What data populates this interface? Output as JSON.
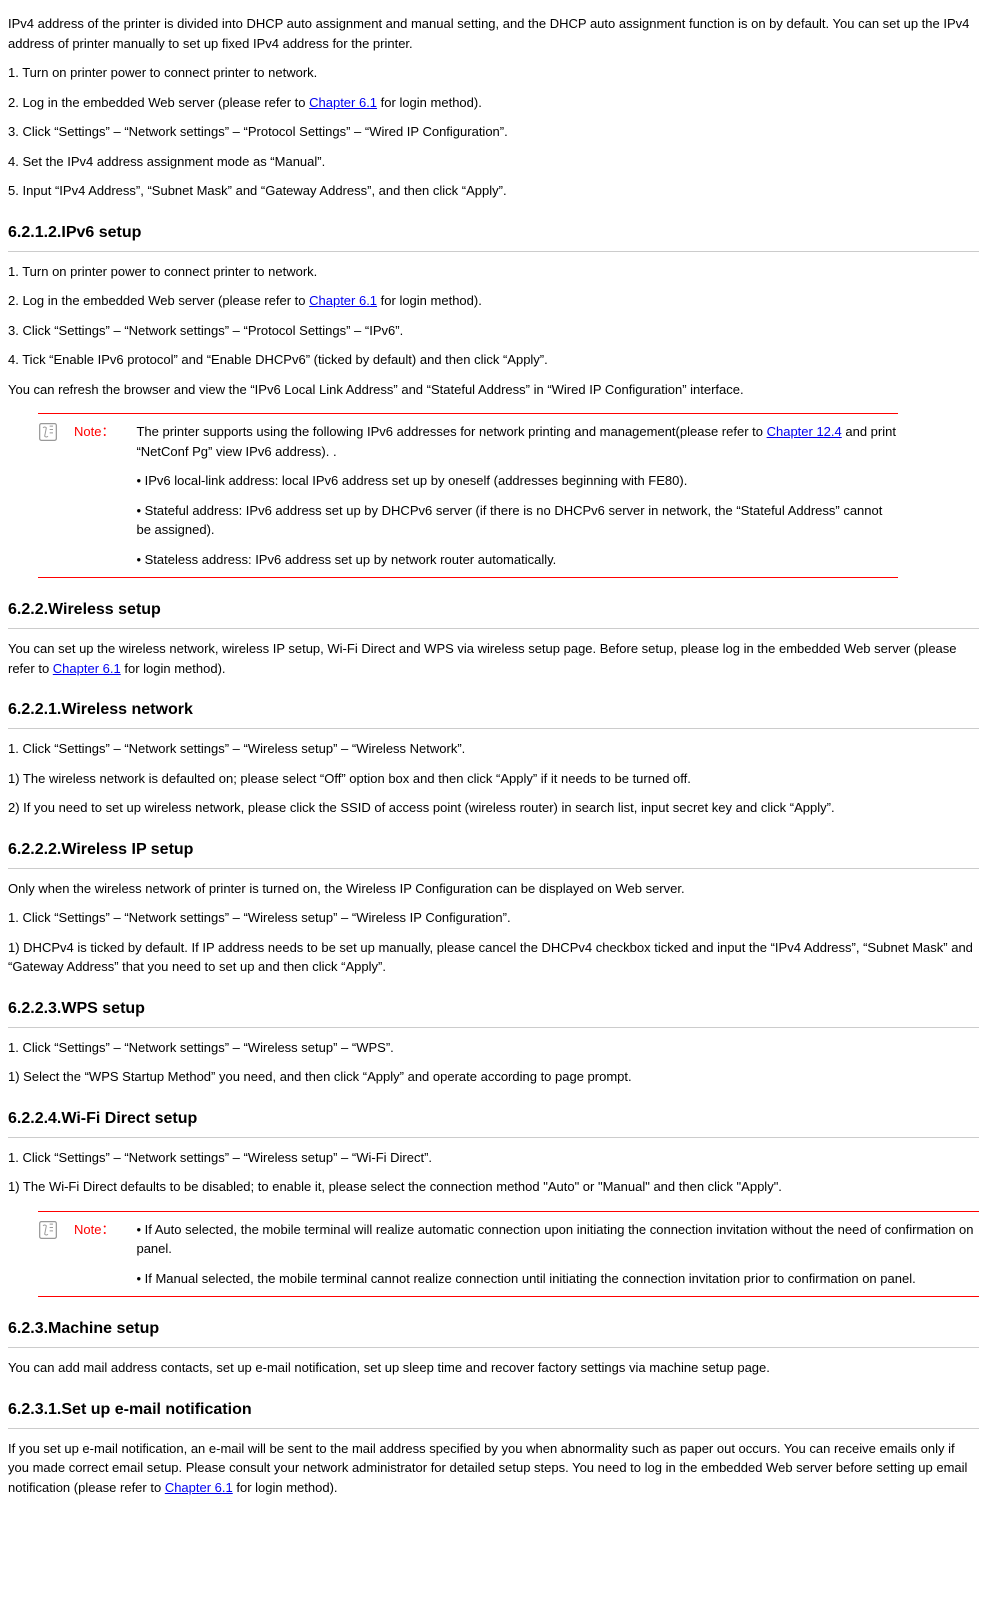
{
  "intro": "IPv4 address of the printer is divided into DHCP auto assignment and manual setting, and the DHCP auto assignment function is on by default. You can set up the IPv4 address of printer manually to set up fixed IPv4 address for the printer.",
  "ipv4_steps": {
    "s1": "1. Turn on printer power to connect printer to network.",
    "s2a": "2. Log in the embedded Web server (please refer to ",
    "s2link": "Chapter 6.1",
    "s2b": " for login method).",
    "s3": "3. Click “Settings” – “Network settings” – “Protocol Settings” – “Wired IP Configuration”.",
    "s4": "4. Set the IPv4 address assignment mode as “Manual”.",
    "s5": "5. Input “IPv4 Address”, “Subnet Mask” and “Gateway Address”, and then click “Apply”."
  },
  "h_ipv6": "6.2.1.2.IPv6 setup",
  "ipv6_steps": {
    "s1": "1. Turn on printer power to connect printer to network.",
    "s2a": "2. Log in the embedded Web server (please refer to ",
    "s2link": "Chapter 6.1",
    "s2b": " for login method).",
    "s3": "3. Click “Settings” – “Network settings” – “Protocol Settings” – “IPv6”.",
    "s4": "4. Tick “Enable IPv6 protocol” and “Enable DHCPv6” (ticked by default) and then click “Apply”.",
    "refresh": "You can refresh the browser and view the “IPv6 Local Link Address” and “Stateful Address” in “Wired IP Configuration” interface."
  },
  "note1": {
    "label": "Note：",
    "l1a": "The printer supports using the following IPv6 addresses for network printing and management(please refer to ",
    "l1link": "Chapter 12.4",
    "l1b": " and print “NetConf Pg” view IPv6 address). .",
    "l2": "• IPv6 local-link address: local IPv6 address set up by oneself (addresses beginning with FE80).",
    "l3": "• Stateful address: IPv6 address set up by DHCPv6 server (if there is no DHCPv6 server in network, the “Stateful Address” cannot be assigned).",
    "l4": "• Stateless address: IPv6 address set up by network router automatically."
  },
  "h_wireless": "6.2.2.Wireless setup",
  "wireless_intro_a": "You can set up the wireless network, wireless IP setup, Wi-Fi Direct and WPS via wireless setup page. Before setup, please log in the embedded Web server (please refer to ",
  "wireless_intro_link": "Chapter 6.1",
  "wireless_intro_b": " for login method).",
  "h_wnet": "6.2.2.1.Wireless network",
  "wnet": {
    "s1": "1. Click “Settings” – “Network settings” – “Wireless setup” – “Wireless Network”.",
    "s2": "1) The wireless network is defaulted on; please select “Off” option box and then click “Apply” if it needs to be turned off.",
    "s3": "2) If you need to set up wireless network, please click the SSID of access point (wireless router) in search list, input secret key and click “Apply”."
  },
  "h_wip": "6.2.2.2.Wireless IP setup",
  "wip": {
    "p1": "Only when the wireless network of printer is turned on, the Wireless IP Configuration can be displayed on Web server.",
    "s1": "1. Click “Settings” – “Network settings” – “Wireless setup” – “Wireless IP Configuration”.",
    "s2": "1) DHCPv4 is ticked by default. If IP address needs to be set up manually, please cancel the DHCPv4 checkbox ticked and input the “IPv4 Address”, “Subnet Mask” and “Gateway Address” that you need to set up and then click “Apply”."
  },
  "h_wps": "6.2.2.3.WPS setup",
  "wps": {
    "s1": "1. Click “Settings” – “Network settings” – “Wireless setup” – “WPS”.",
    "s2": "1) Select the “WPS Startup Method” you need, and then click “Apply” and operate according to page prompt."
  },
  "h_wifi": "6.2.2.4.Wi-Fi Direct setup",
  "wifi": {
    "s1": "1. Click “Settings” – “Network settings” – “Wireless setup” – “Wi-Fi Direct”.",
    "s2": "1) The Wi-Fi Direct defaults to be disabled; to enable it, please select the connection method \"Auto\" or \"Manual\" and then click \"Apply\"."
  },
  "note2": {
    "label": "Note：",
    "l1": "• If Auto selected, the mobile terminal will realize automatic connection upon initiating the connection invitation without the need of confirmation on panel.",
    "l2": "• If Manual selected, the mobile terminal cannot realize connection until initiating the connection invitation prior to confirmation on panel."
  },
  "h_machine": "6.2.3.Machine setup",
  "machine_intro": "You can add mail address contacts, set up e-mail notification, set up sleep time and recover factory settings via machine setup page.",
  "h_email": "6.2.3.1.Set up e-mail notification",
  "email_intro_a": "If you set up e-mail notification, an e-mail will be sent to the mail address specified by you when abnormality such as paper out occurs. You can receive emails only if you made correct email setup. Please consult your network administrator for detailed setup steps. You need to log in the embedded Web server before setting up email notification (please refer to ",
  "email_intro_link": "Chapter 6.1",
  "email_intro_b": " for login method)."
}
